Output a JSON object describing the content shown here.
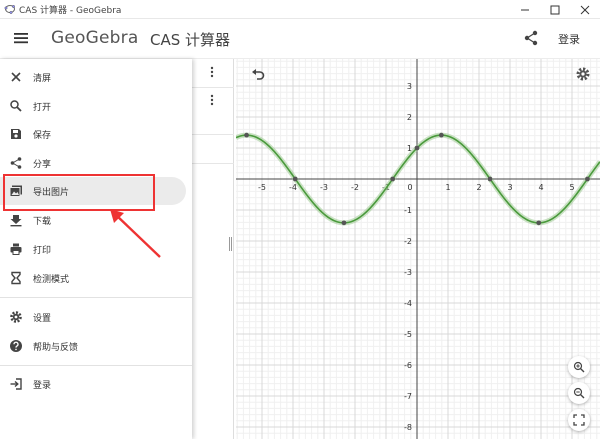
{
  "window": {
    "title": "CAS 计算器 - GeoGebra"
  },
  "header": {
    "logo": "GeoGebra",
    "title": "CAS 计算器",
    "login": "登录"
  },
  "menu": {
    "items": [
      {
        "label": "清屏",
        "icon": "close-icon"
      },
      {
        "label": "打开",
        "icon": "search-icon"
      },
      {
        "label": "保存",
        "icon": "save-icon"
      },
      {
        "label": "分享",
        "icon": "share-icon"
      },
      {
        "label": "导出图片",
        "icon": "image-icon",
        "active": true
      },
      {
        "label": "下载",
        "icon": "download-icon"
      },
      {
        "label": "打印",
        "icon": "print-icon"
      },
      {
        "label": "检测模式",
        "icon": "hourglass-icon"
      },
      {
        "label": "设置",
        "icon": "gear-icon"
      },
      {
        "label": "帮助与反馈",
        "icon": "help-icon"
      },
      {
        "label": "登录",
        "icon": "sign-in-icon"
      }
    ]
  },
  "graph": {
    "x_ticks": [
      "-5",
      "-4",
      "-3",
      "-2",
      "-1",
      "0",
      "1",
      "2",
      "3",
      "4",
      "5"
    ],
    "y_ticks": [
      "3",
      "2",
      "1",
      "-1",
      "-2",
      "-3",
      "-4",
      "-5",
      "-6",
      "-7",
      "-8"
    ],
    "curve_color": "#4a9a3c",
    "point_color": "#555555"
  },
  "annotation": {
    "highlight_color": "#e33333"
  }
}
